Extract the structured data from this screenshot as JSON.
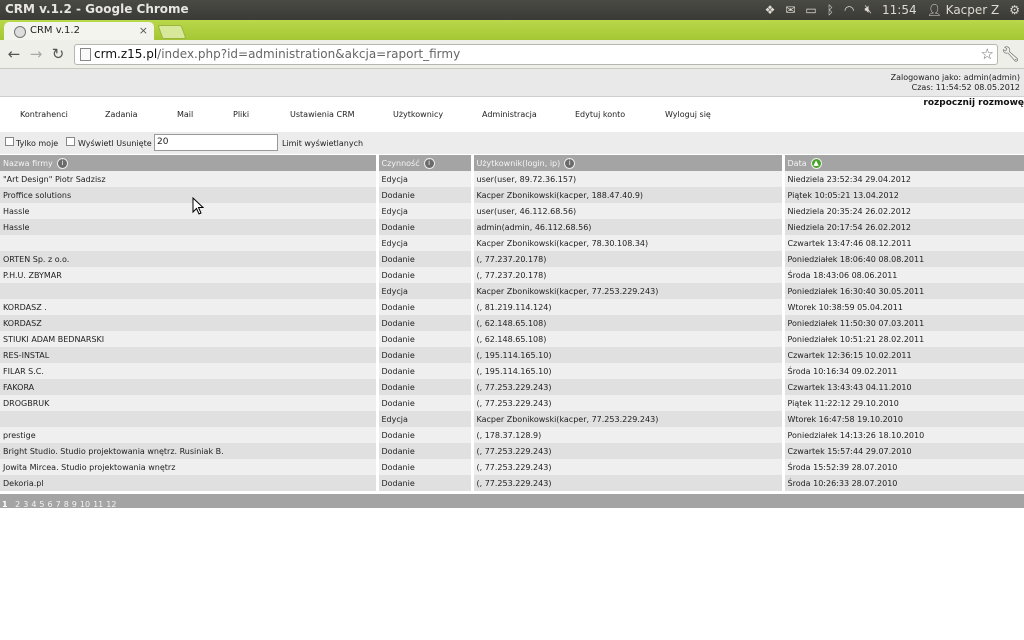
{
  "os": {
    "window_title": "CRM v.1.2 - Google Chrome",
    "clock": "11:54",
    "user": "Kacper Z"
  },
  "browser": {
    "tab_title": "CRM v.1.2",
    "url_host": "crm.z15.pl",
    "url_path": "/index.php?id=administration&akcja=raport_firmy"
  },
  "header": {
    "logged_in": "Zalogowano jako: admin(admin)",
    "time": "Czas: 11:54:52 08.05.2012",
    "chat_link": "rozpocznij rozmowę"
  },
  "menu": [
    "Kontrahenci",
    "Zadania",
    "Mail",
    "Pliki",
    "Ustawienia CRM",
    "Użytkownicy",
    "Administracja",
    "Edytuj konto",
    "Wyloguj się"
  ],
  "filters": {
    "only_mine_label": "Tylko moje",
    "show_deleted_label": "Wyświetl Usunięte",
    "limit_value": "20",
    "limit_label": "Limit wyświetlanych"
  },
  "table": {
    "columns": [
      "Nazwa firmy",
      "Czynność",
      "Użytkownik(login, ip)",
      "Data"
    ],
    "rows": [
      [
        "\"Art Design\" Piotr Sadzisz",
        "Edycja",
        "user(user, 89.72.36.157)",
        "Niedziela 23:52:34 29.04.2012"
      ],
      [
        "Proffice solutions",
        "Dodanie",
        "Kacper Zbonikowski(kacper, 188.47.40.9)",
        "Piątek 10:05:21 13.04.2012"
      ],
      [
        "Hassle",
        "Edycja",
        "user(user, 46.112.68.56)",
        "Niedziela 20:35:24 26.02.2012"
      ],
      [
        "Hassle",
        "Dodanie",
        "admin(admin, 46.112.68.56)",
        "Niedziela 20:17:54 26.02.2012"
      ],
      [
        "",
        "Edycja",
        "Kacper Zbonikowski(kacper, 78.30.108.34)",
        "Czwartek 13:47:46 08.12.2011"
      ],
      [
        "ORTEN Sp. z o.o.",
        "Dodanie",
        "(, 77.237.20.178)",
        "Poniedziałek 18:06:40 08.08.2011"
      ],
      [
        "P.H.U. ZBYMAR",
        "Dodanie",
        "(, 77.237.20.178)",
        "Środa 18:43:06 08.06.2011"
      ],
      [
        "",
        "Edycja",
        "Kacper Zbonikowski(kacper, 77.253.229.243)",
        "Poniedziałek 16:30:40 30.05.2011"
      ],
      [
        "KORDASZ .",
        "Dodanie",
        "(, 81.219.114.124)",
        "Wtorek 10:38:59 05.04.2011"
      ],
      [
        "KORDASZ",
        "Dodanie",
        "(, 62.148.65.108)",
        "Poniedziałek 11:50:30 07.03.2011"
      ],
      [
        "STIUKI ADAM BEDNARSKI",
        "Dodanie",
        "(, 62.148.65.108)",
        "Poniedziałek 10:51:21 28.02.2011"
      ],
      [
        "RES-INSTAL",
        "Dodanie",
        "(, 195.114.165.10)",
        "Czwartek 12:36:15 10.02.2011"
      ],
      [
        "FILAR S.C.",
        "Dodanie",
        "(, 195.114.165.10)",
        "Środa 10:16:34 09.02.2011"
      ],
      [
        "FAKORA",
        "Dodanie",
        "(, 77.253.229.243)",
        "Czwartek 13:43:43 04.11.2010"
      ],
      [
        "DROGBRUK",
        "Dodanie",
        "(, 77.253.229.243)",
        "Piątek 11:22:12 29.10.2010"
      ],
      [
        "",
        "Edycja",
        "Kacper Zbonikowski(kacper, 77.253.229.243)",
        "Wtorek 16:47:58 19.10.2010"
      ],
      [
        "prestige",
        "Dodanie",
        "(, 178.37.128.9)",
        "Poniedziałek 14:13:26 18.10.2010"
      ],
      [
        "Bright Studio. Studio projektowania wnętrz. Rusiniak B.",
        "Dodanie",
        "(, 77.253.229.243)",
        "Czwartek 15:57:44 29.07.2010"
      ],
      [
        "Jowita Mircea. Studio projektowania wnętrz",
        "Dodanie",
        "(, 77.253.229.243)",
        "Środa 15:52:39 28.07.2010"
      ],
      [
        "Dekoria.pl",
        "Dodanie",
        "(, 77.253.229.243)",
        "Środa 10:26:33 28.07.2010"
      ]
    ]
  },
  "pager": {
    "current": "1",
    "pages": [
      "2",
      "3",
      "4",
      "5",
      "6",
      "7",
      "8",
      "9",
      "10",
      "11",
      "12"
    ]
  }
}
